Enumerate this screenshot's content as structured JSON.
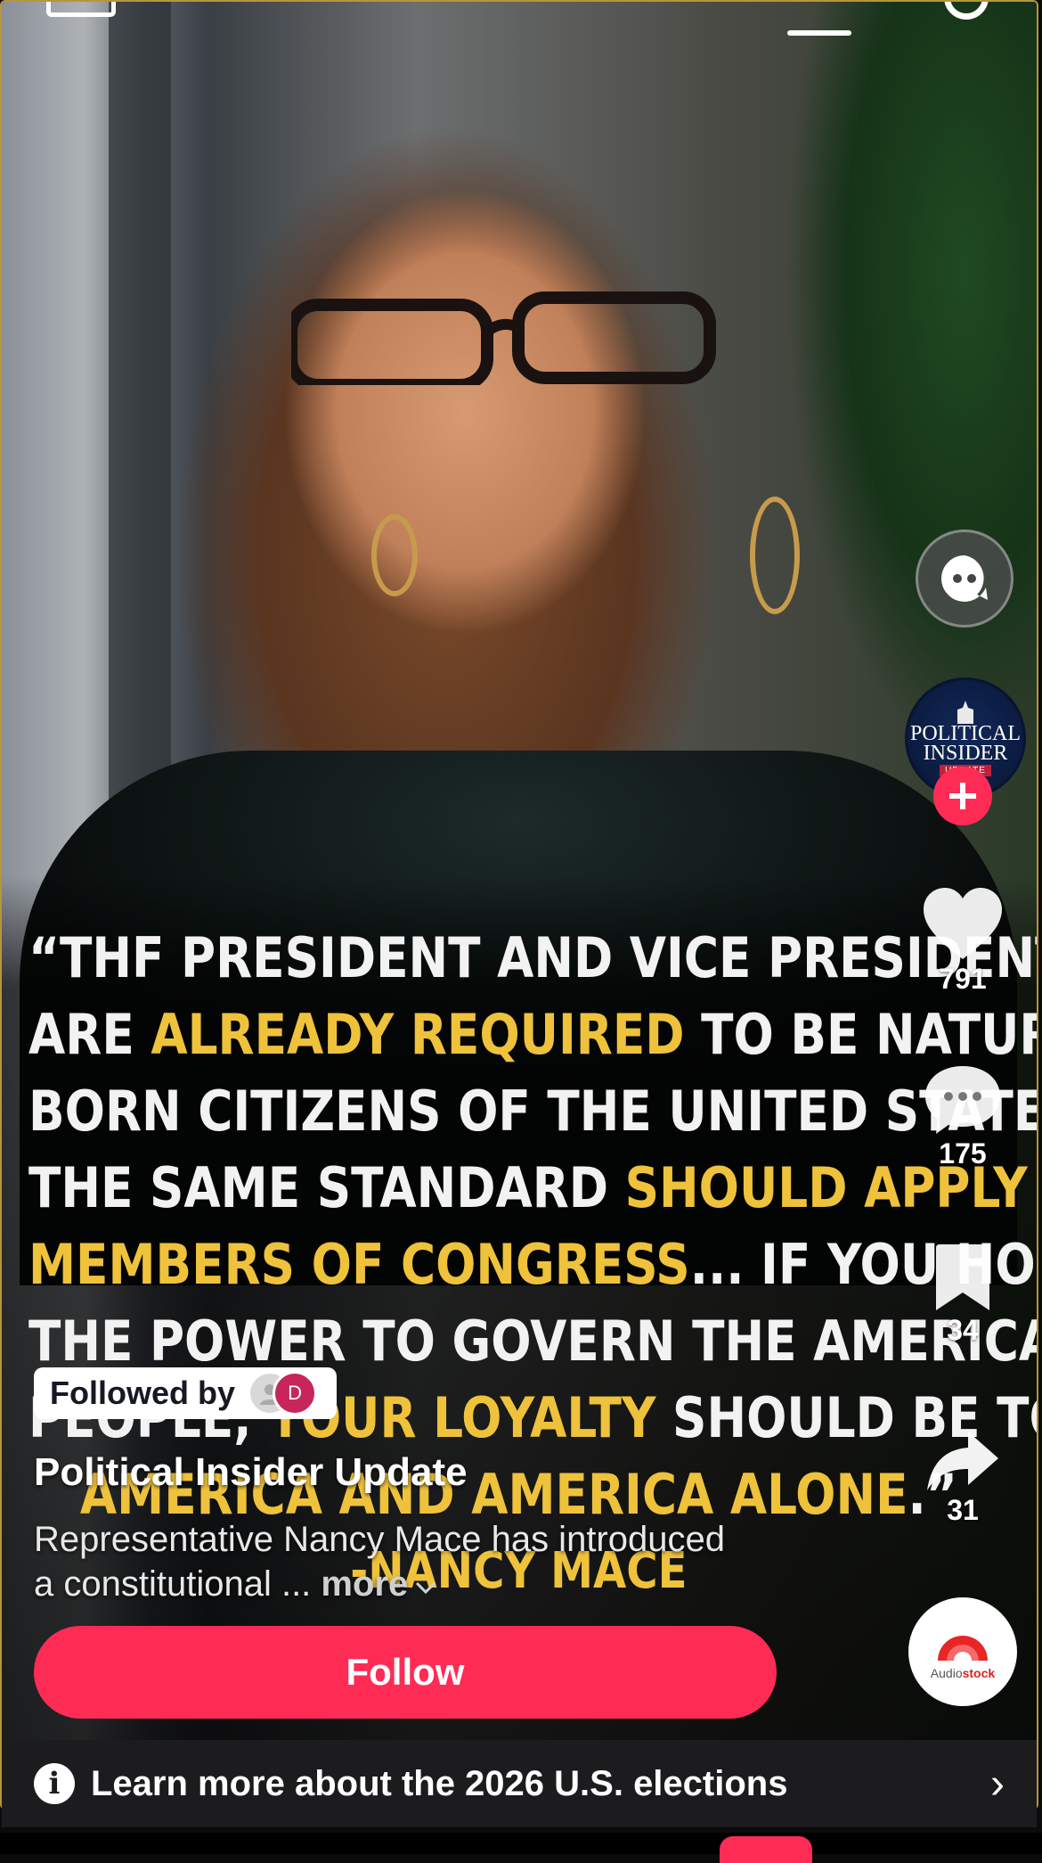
{
  "quote": {
    "lines": [
      [
        {
          "t": "“THF PRESIDENT AND VICE PRESIDENT",
          "hl": false
        }
      ],
      [
        {
          "t": "ARE ",
          "hl": false
        },
        {
          "t": "ALREADY REQUIRED",
          "hl": true
        },
        {
          "t": " TO BE NATURAL",
          "hl": false
        }
      ],
      [
        {
          "t": "BORN CITIZENS OF THE UNITED STATES.",
          "hl": false
        }
      ],
      [
        {
          "t": "THE SAME STANDARD ",
          "hl": false
        },
        {
          "t": "SHOULD APPLY TO",
          "hl": true
        }
      ],
      [
        {
          "t": "MEMBERS OF CONGRESS",
          "hl": true
        },
        {
          "t": "... IF YOU HOLD",
          "hl": false
        }
      ],
      [
        {
          "t": "THE POWER TO GOVERN THE AMERICAN",
          "hl": false
        }
      ],
      [
        {
          "t": "PEOPLE, ",
          "hl": false
        },
        {
          "t": "YOUR LOYALTY",
          "hl": true
        },
        {
          "t": " SHOULD BE TO",
          "hl": false
        }
      ],
      [
        {
          "t": "AMERICA AND AMERICA ALONE",
          "hl": true
        },
        {
          "t": ".”",
          "hl": false
        }
      ]
    ],
    "signature": "-NANCY MACE"
  },
  "rail": {
    "avatar_top": "POLITICAL",
    "avatar_mid": "INSIDER",
    "avatar_badge": "UPDATE",
    "likes": "791",
    "comments": "175",
    "saves": "34",
    "shares": "31",
    "sound_label_a": "Audio",
    "sound_label_b": "stock"
  },
  "post": {
    "followed_by": "Followed by",
    "follower_initial": "D",
    "username": "Political Insider Update",
    "caption": "Representative Nancy Mace has introduced a constitutional ...",
    "more": "more"
  },
  "follow_button": "Follow",
  "banner": {
    "text": "Learn more about the 2026 U.S. elections",
    "info_glyph": "i",
    "chevron": "›"
  },
  "colors": {
    "accent": "#fe2c55",
    "quote_highlight": "#efc23b",
    "frame": "#b8953a"
  },
  "icons": [
    "menu-icon",
    "search-icon",
    "chatbot-icon",
    "heart-icon",
    "comment-icon",
    "bookmark-icon",
    "share-icon",
    "info-icon",
    "chevron-right-icon",
    "plus-icon",
    "chevron-down-icon"
  ]
}
